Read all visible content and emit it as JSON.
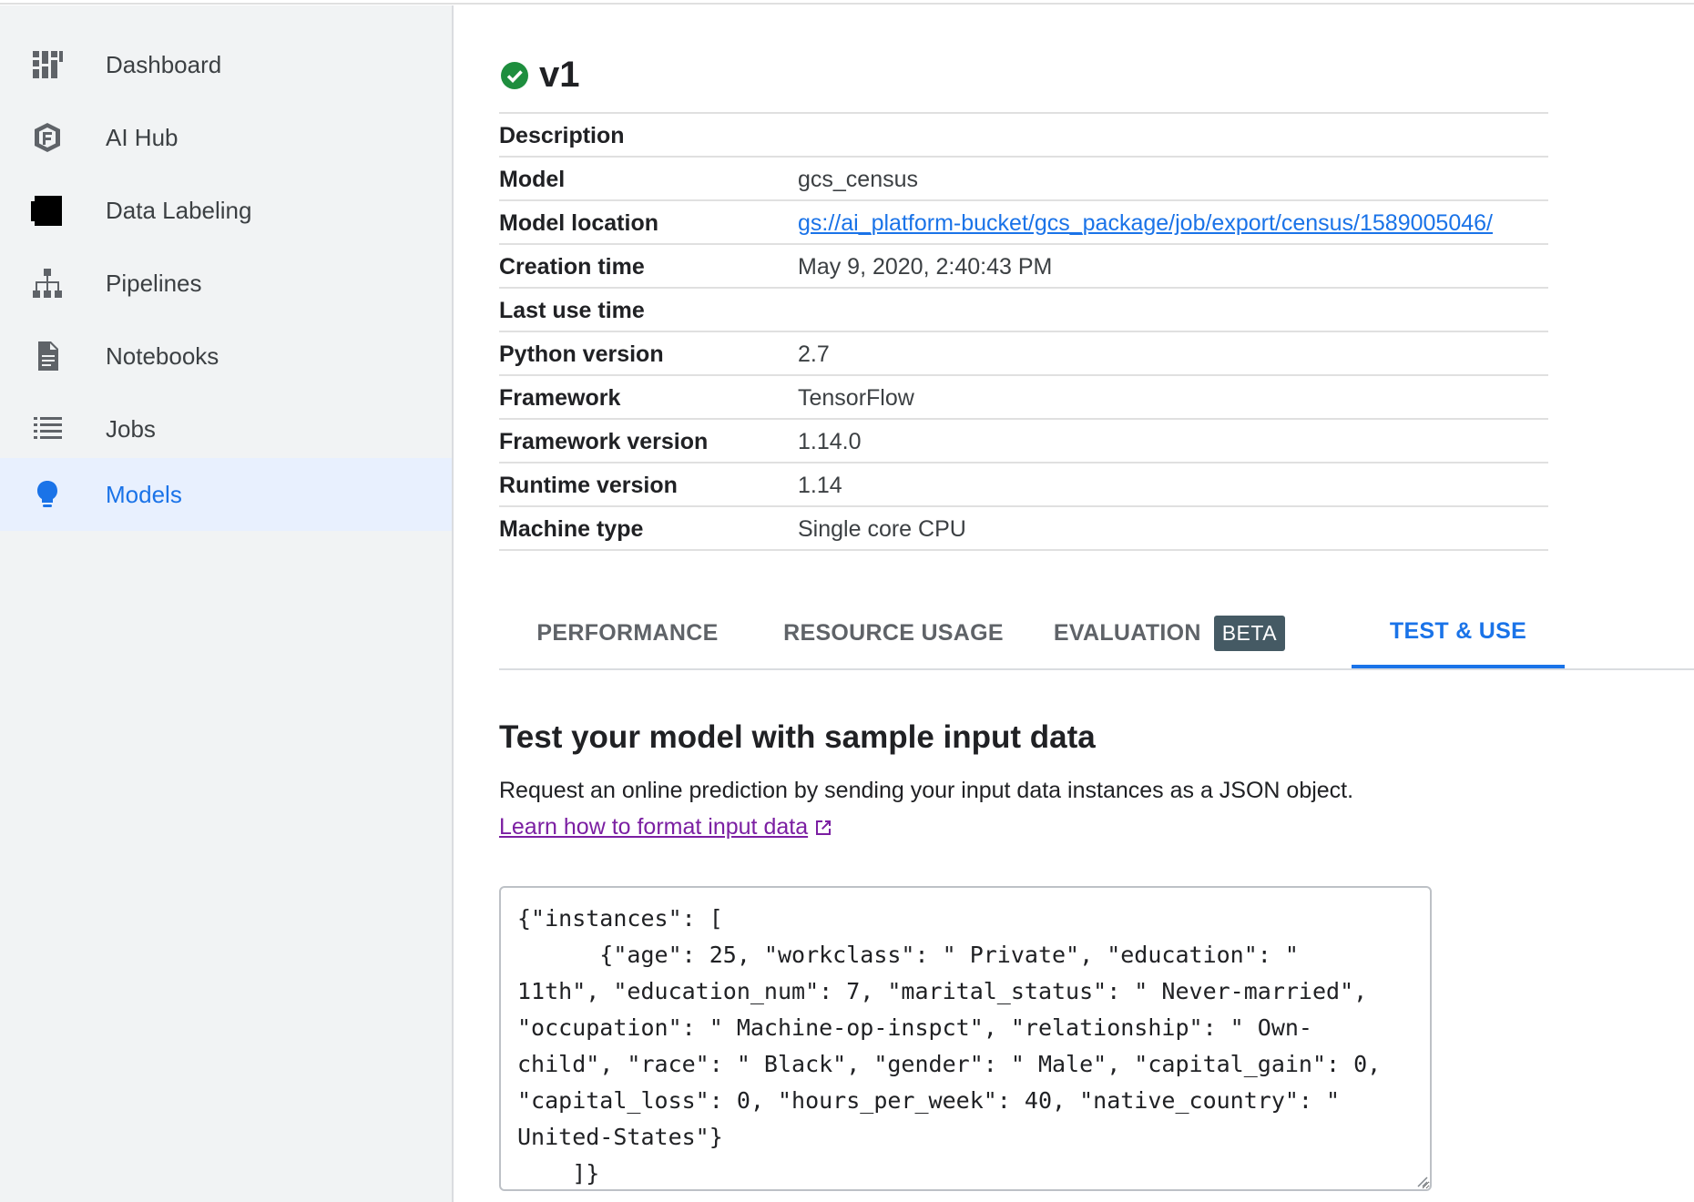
{
  "sidebar": {
    "items": [
      {
        "label": "Dashboard",
        "icon": "dashboard-icon",
        "active": false
      },
      {
        "label": "AI Hub",
        "icon": "ai-hub-icon",
        "active": false
      },
      {
        "label": "Data Labeling",
        "icon": "data-labeling-icon",
        "active": false
      },
      {
        "label": "Pipelines",
        "icon": "pipelines-icon",
        "active": false
      },
      {
        "label": "Notebooks",
        "icon": "notebooks-icon",
        "active": false
      },
      {
        "label": "Jobs",
        "icon": "jobs-icon",
        "active": false
      },
      {
        "label": "Models",
        "icon": "lightbulb-icon",
        "active": true
      }
    ]
  },
  "header": {
    "title": "v1",
    "status_icon": "check-circle-icon",
    "status_color": "#1e8e3e"
  },
  "details": {
    "rows": [
      {
        "key": "Description",
        "value": ""
      },
      {
        "key": "Model",
        "value": "gcs_census"
      },
      {
        "key": "Model location",
        "value": "gs://ai_platform-bucket/gcs_package/job/export/census/1589005046/"
      },
      {
        "key": "Creation time",
        "value": "May 9, 2020, 2:40:43 PM"
      },
      {
        "key": "Last use time",
        "value": ""
      },
      {
        "key": "Python version",
        "value": "2.7"
      },
      {
        "key": "Framework",
        "value": "TensorFlow"
      },
      {
        "key": "Framework version",
        "value": "1.14.0"
      },
      {
        "key": "Runtime version",
        "value": "1.14"
      },
      {
        "key": "Machine type",
        "value": "Single core CPU"
      }
    ]
  },
  "tabs": {
    "items": [
      {
        "label": "PERFORMANCE",
        "active": false
      },
      {
        "label": "RESOURCE USAGE",
        "active": false
      },
      {
        "label": "EVALUATION",
        "badge": "BETA",
        "active": false
      },
      {
        "label": "TEST & USE",
        "active": true
      }
    ]
  },
  "test_section": {
    "title": "Test your model with sample input data",
    "description": "Request an online prediction by sending your input data instances as a JSON object.",
    "link_label": "Learn how to format input data",
    "json_input": "{\"instances\": [\n      {\"age\": 25, \"workclass\": \" Private\", \"education\": \"\n11th\", \"education_num\": 7, \"marital_status\": \" Never-married\",\n\"occupation\": \" Machine-op-inspct\", \"relationship\": \" Own-\nchild\", \"race\": \" Black\", \"gender\": \" Male\", \"capital_gain\": 0,\n\"capital_loss\": 0, \"hours_per_week\": 40, \"native_country\": \"\nUnited-States\"}\n    ]}"
  },
  "colors": {
    "accent": "#1a73e8",
    "link_visited": "#7b1fa2",
    "badge_bg": "#455a64",
    "sidebar_bg": "#f1f3f4",
    "active_bg": "#e8f0fe"
  }
}
